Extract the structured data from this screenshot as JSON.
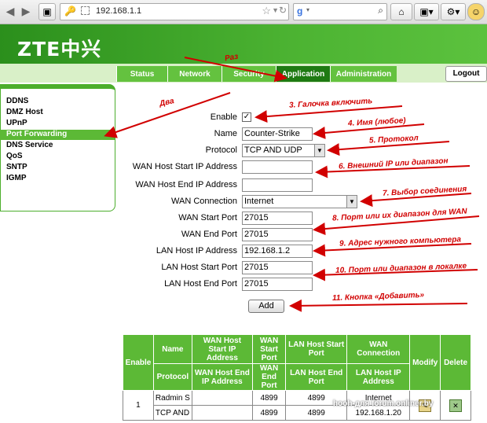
{
  "browser": {
    "url": "192.168.1.1",
    "back_icon": "back-arrow-icon",
    "forward_icon": "forward-arrow-icon"
  },
  "header": {
    "logo": "ZTE中兴"
  },
  "nav": {
    "tabs": [
      "Status",
      "Network",
      "Security",
      "Application",
      "Administration"
    ],
    "active_tab": "Application",
    "logout": "Logout"
  },
  "sidebar": {
    "items": [
      "DDNS",
      "DMZ Host",
      "UPnP",
      "Port Forwarding",
      "DNS Service",
      "QoS",
      "SNTP",
      "IGMP"
    ],
    "active": "Port Forwarding"
  },
  "form": {
    "enable_label": "Enable",
    "enable_checked": true,
    "name_label": "Name",
    "name_value": "Counter-Strike",
    "protocol_label": "Protocol",
    "protocol_value": "TCP AND UDP",
    "wan_start_ip_label": "WAN Host Start IP Address",
    "wan_start_ip_value": "",
    "wan_end_ip_label": "WAN Host End IP Address",
    "wan_end_ip_value": "",
    "wan_conn_label": "WAN Connection",
    "wan_conn_value": "Internet",
    "wan_start_port_label": "WAN Start Port",
    "wan_start_port_value": "27015",
    "wan_end_port_label": "WAN End Port",
    "wan_end_port_value": "27015",
    "lan_ip_label": "LAN Host IP Address",
    "lan_ip_value": "192.168.1.2",
    "lan_start_port_label": "LAN Host Start Port",
    "lan_start_port_value": "27015",
    "lan_end_port_label": "LAN Host End Port",
    "lan_end_port_value": "27015",
    "add_button": "Add"
  },
  "annotations": {
    "raz": "Раз",
    "dva": "Два",
    "a3": "3. Галочка включить",
    "a4": "4. Имя (любое)",
    "a5": "5. Протокол",
    "a6": "6. Внешний IP или диапазон",
    "a7": "7. Выбор соединения",
    "a8": "8. Порт или их диапазон для WAN",
    "a9": "9. Адрес нужного компьютера",
    "a10": "10. Порт или диапазон в локалке",
    "a11": "11. Кнопка «Добавить»"
  },
  "table": {
    "headers": {
      "enable": "Enable",
      "name": "Name",
      "protocol": "Protocol",
      "wan_start_ip": "WAN Host Start IP Address",
      "wan_end_ip": "WAN Host End IP Address",
      "wan_start_port": "WAN Start Port",
      "wan_end_port": "WAN End Port",
      "lan_start_port": "LAN Host Start Port",
      "lan_end_port": "LAN Host End Port",
      "wan_conn": "WAN Connection",
      "lan_ip": "LAN Host IP Address",
      "modify": "Modify",
      "delete": "Delete"
    },
    "row": {
      "index": "1",
      "name": "Radmin S",
      "protocol": "TCP AND",
      "wan_start_port": "4899",
      "wan_end_port": "4899",
      "lan_start_port": "4899",
      "lan_end_port": "4899",
      "wan_conn": "Internet",
      "lan_ip": "192.168.1.20"
    }
  },
  "watermark": "hooh-для forum.onliner.by",
  "colors": {
    "brand_green": "#4cb332",
    "active_tab": "#1e7a12",
    "annotation_red": "#d10000"
  }
}
